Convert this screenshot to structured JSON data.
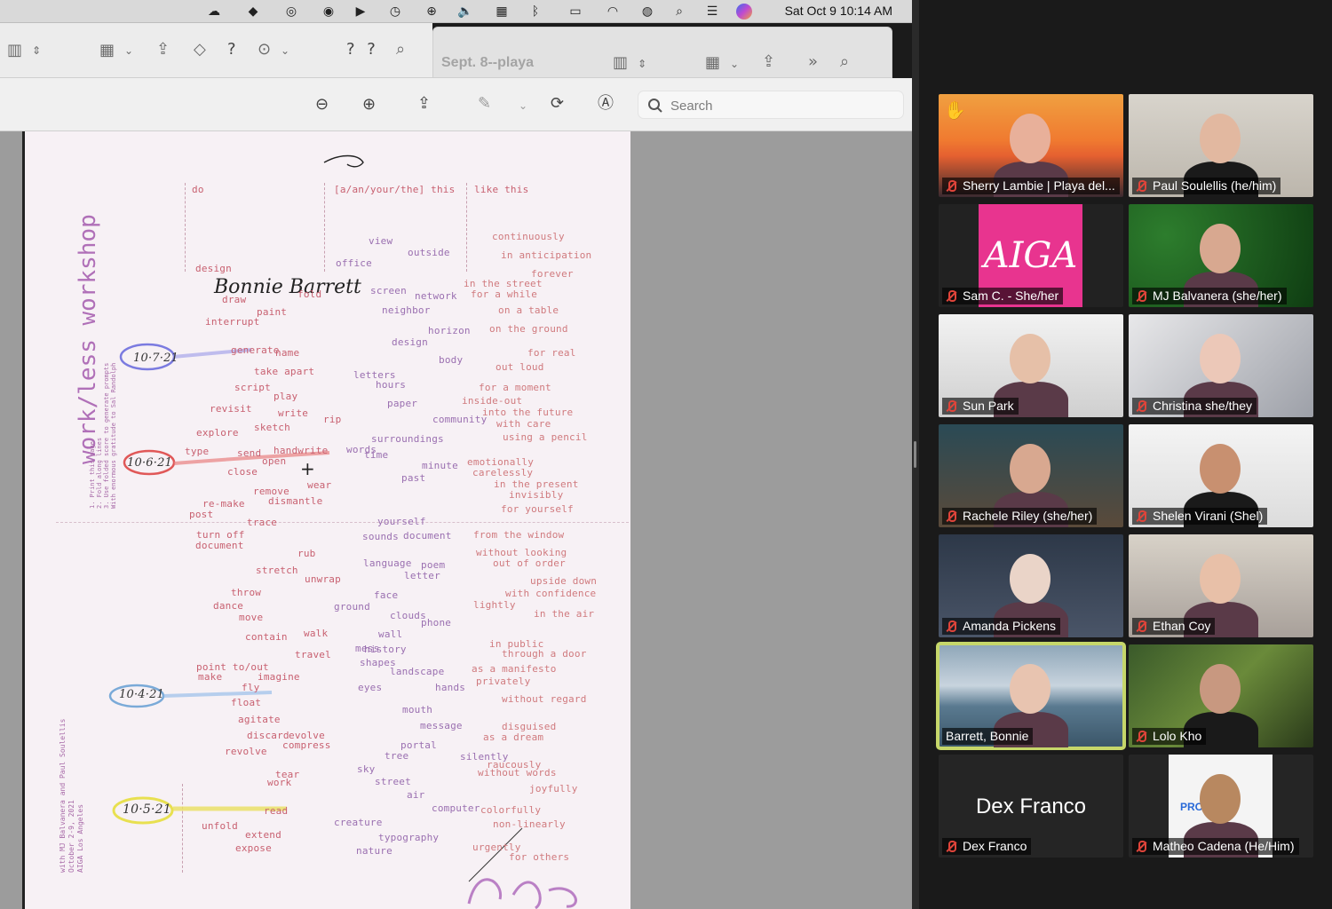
{
  "menubar": {
    "clock": "Sat Oct 9  10:14 AM",
    "icons": [
      "creative-cloud-icon",
      "dropbox-icon",
      "sync-icon",
      "vpn-icon",
      "play-icon",
      "time-machine-icon",
      "accessibility-icon",
      "volume-icon",
      "keyboard-icon",
      "bluetooth-icon",
      "battery-icon",
      "wifi-icon",
      "user-icon",
      "spotlight-icon",
      "control-center-icon",
      "siri-icon"
    ]
  },
  "notes_window": {
    "toolbar_left_help": "?",
    "toolbar_help_pair": "? ?",
    "tab_title": "Sept. 8--playa"
  },
  "preview_toolbar": {
    "search_placeholder": "Search"
  },
  "document": {
    "signature": "Bonnie Barrett",
    "title": "work/less workshop",
    "instructions": [
      "1. Print this page",
      "2. Fold along lines",
      "3. Use folded score to generate prompts",
      "With enormous gratitude to Sal Randolph"
    ],
    "credits": [
      "with MJ Balvanera and Paul Soulellis",
      "October 2-9, 2021",
      "AIGA Los Angeles"
    ],
    "column_headers": [
      "do",
      "[a/an/your/the] this",
      "like this"
    ],
    "dates": [
      "10·7·21",
      "10·6·21",
      "10·4·21",
      "10·5·21"
    ],
    "words": {
      "verbs": [
        "design",
        "draw",
        "fold",
        "paint",
        "interrupt",
        "generate",
        "name",
        "take apart",
        "script",
        "play",
        "revisit",
        "write",
        "explore",
        "sketch",
        "type",
        "send",
        "handwrite",
        "open",
        "close",
        "wear",
        "remove",
        "dismantle",
        "re-make",
        "post",
        "trace",
        "turn off",
        "document",
        "rub",
        "stretch",
        "unwrap",
        "throw",
        "dance",
        "move",
        "contain",
        "walk",
        "travel",
        "point to/out",
        "make",
        "imagine",
        "fly",
        "float",
        "agitate",
        "discard",
        "revolve",
        "evolve",
        "compress",
        "tear",
        "work",
        "read",
        "unfold",
        "extend",
        "expose",
        "rip"
      ],
      "things": [
        "view",
        "outside",
        "office",
        "screen",
        "network",
        "neighbor",
        "horizon",
        "design",
        "body",
        "letters",
        "hours",
        "paper",
        "community",
        "surroundings",
        "words",
        "time",
        "minute",
        "past",
        "yourself",
        "document",
        "sounds",
        "language",
        "poem",
        "letter",
        "face",
        "ground",
        "clouds",
        "wall",
        "history",
        "phone",
        "mess",
        "shapes",
        "landscape",
        "eyes",
        "hands",
        "mouth",
        "message",
        "portal",
        "tree",
        "silently",
        "sky",
        "street",
        "air",
        "computer",
        "creature",
        "typography",
        "nature"
      ],
      "manners": [
        "continuously",
        "in anticipation",
        "forever",
        "in the street",
        "for a while",
        "on a table",
        "on the ground",
        "for real",
        "out loud",
        "for a moment",
        "inside-out",
        "into the future",
        "with care",
        "using a pencil",
        "emotionally",
        "carelessly",
        "in the present",
        "invisibly",
        "for yourself",
        "from the window",
        "without looking",
        "out of order",
        "upside down",
        "with confidence",
        "lightly",
        "in the air",
        "in public",
        "through a door",
        "as a manifesto",
        "privately",
        "without regard",
        "disguised",
        "without words",
        "as a dream",
        "raucously",
        "joyfully",
        "colorfully",
        "non-linearly",
        "urgently",
        "for others"
      ]
    }
  },
  "participants": [
    {
      "name": "Sherry Lambie | Playa del...",
      "muted": true,
      "hand_raised": true
    },
    {
      "name": "Paul Soulellis (he/him)",
      "muted": true
    },
    {
      "name": "Sam C. - She/her",
      "muted": true,
      "logo_text": "AIGA"
    },
    {
      "name": "MJ Balvanera (she/her)",
      "muted": true
    },
    {
      "name": "Sun Park",
      "muted": true
    },
    {
      "name": "Christina she/they",
      "muted": true
    },
    {
      "name": "Rachele Riley (she/her)",
      "muted": true
    },
    {
      "name": "Shelen Virani (Shel)",
      "muted": true
    },
    {
      "name": "Amanda Pickens",
      "muted": true
    },
    {
      "name": "Ethan Coy",
      "muted": true
    },
    {
      "name": "Barrett, Bonnie",
      "muted": false,
      "active_speaker": true
    },
    {
      "name": "Lolo Kho",
      "muted": true
    },
    {
      "name": "Dex Franco",
      "muted": true,
      "video_off_label": "Dex Franco"
    },
    {
      "name": "Matheo Cadena (He/Him)",
      "muted": true,
      "background_text": "PROUD"
    }
  ],
  "colors": {
    "active_speaker_border": "#c6d76a",
    "aiga_pink": "#e8348f",
    "mute_red": "#e0443a"
  }
}
